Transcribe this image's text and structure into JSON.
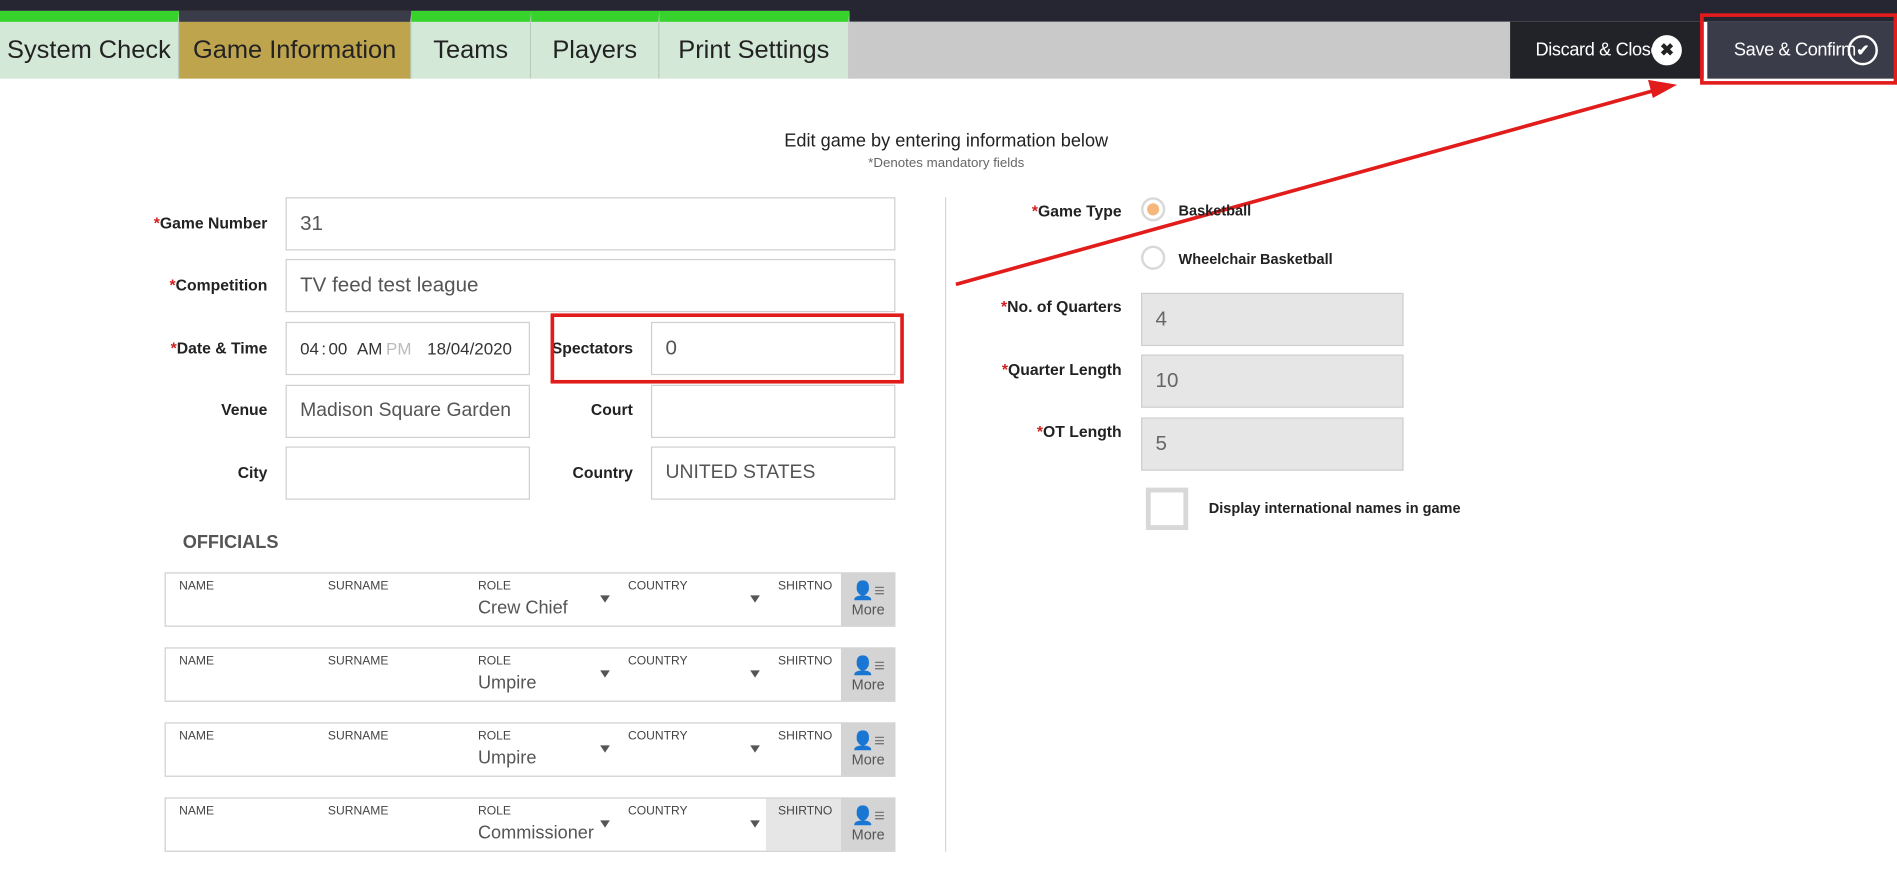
{
  "tabs": [
    {
      "label": "System Check"
    },
    {
      "label": "Game Information"
    },
    {
      "label": "Teams"
    },
    {
      "label": "Players"
    },
    {
      "label": "Print Settings"
    }
  ],
  "actions": {
    "discard_label": "Discard & Close",
    "save_label": "Save & Confirm"
  },
  "header": {
    "title": "Edit game by entering information below",
    "subtitle": "*Denotes mandatory fields"
  },
  "form": {
    "game_number": {
      "label": "Game Number",
      "value": "31"
    },
    "competition": {
      "label": "Competition",
      "value": "TV feed test league"
    },
    "date_time": {
      "label": "Date & Time",
      "hour": "04",
      "minute": "00",
      "am": "AM",
      "pm": "PM",
      "date": "18/04/2020"
    },
    "spectators": {
      "label": "Spectators",
      "value": "0"
    },
    "venue": {
      "label": "Venue",
      "value": "Madison Square Garden"
    },
    "court": {
      "label": "Court",
      "value": ""
    },
    "city": {
      "label": "City",
      "value": ""
    },
    "country": {
      "label": "Country",
      "value": "UNITED STATES"
    }
  },
  "settings": {
    "game_type_label": "Game Type",
    "game_types": [
      "Basketball",
      "Wheelchair Basketball"
    ],
    "quarters": {
      "label": "No. of Quarters",
      "value": "4"
    },
    "quarter_length": {
      "label": "Quarter Length",
      "value": "10"
    },
    "ot_length": {
      "label": "OT Length",
      "value": "5"
    },
    "intl_names_label": "Display international names in game"
  },
  "officials": {
    "title": "OFFICIALS",
    "headers": {
      "name": "NAME",
      "surname": "SURNAME",
      "role": "ROLE",
      "country": "COUNTRY",
      "shirtno": "SHIRTNO"
    },
    "more_label": "More",
    "rows": [
      {
        "role": "Crew Chief"
      },
      {
        "role": "Umpire"
      },
      {
        "role": "Umpire"
      },
      {
        "role": "Commissioner"
      }
    ]
  },
  "colors": {
    "accent_green": "#37d22b",
    "active_tab": "#bfa44e",
    "highlight_red": "#e21b1b"
  }
}
